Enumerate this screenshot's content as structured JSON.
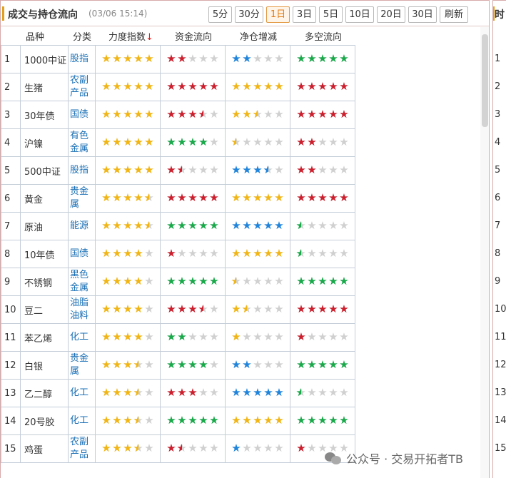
{
  "panel": {
    "title": "成交与持仓流向",
    "timestamp": "(03/06 15:14)",
    "buttons": [
      {
        "label": "5分",
        "active": false
      },
      {
        "label": "30分",
        "active": false
      },
      {
        "label": "1日",
        "active": true
      },
      {
        "label": "3日",
        "active": false
      },
      {
        "label": "5日",
        "active": false
      },
      {
        "label": "10日",
        "active": false
      },
      {
        "label": "20日",
        "active": false
      },
      {
        "label": "30日",
        "active": false
      },
      {
        "label": "刷新",
        "active": false
      }
    ]
  },
  "columns": {
    "name": "品种",
    "category": "分类",
    "strength": "力度指数",
    "strength_sort": "↓",
    "capital": "资金流向",
    "position": "净仓增减",
    "longshort": "多空流向"
  },
  "colors": {
    "gold": "#f2b614",
    "red": "#cc1f2d",
    "green": "#19a94a",
    "blue": "#1e84dc",
    "empty": "#d0d0d0",
    "category": "#1a6fb5"
  },
  "rows": [
    {
      "idx": "1",
      "name": "1000中证",
      "category": "股指",
      "strength": 5,
      "capital": {
        "v": 2,
        "c": "red"
      },
      "position": {
        "v": 2,
        "c": "blue"
      },
      "longshort": {
        "v": 5,
        "c": "green"
      }
    },
    {
      "idx": "2",
      "name": "生猪",
      "category": "农副产品",
      "strength": 5,
      "capital": {
        "v": 5,
        "c": "red"
      },
      "position": {
        "v": 5,
        "c": "gold"
      },
      "longshort": {
        "v": 5,
        "c": "red"
      }
    },
    {
      "idx": "3",
      "name": "30年债",
      "category": "国债",
      "strength": 5,
      "capital": {
        "v": 3.5,
        "c": "red"
      },
      "position": {
        "v": 2.5,
        "c": "gold"
      },
      "longshort": {
        "v": 5,
        "c": "red"
      }
    },
    {
      "idx": "4",
      "name": "沪镍",
      "category": "有色金属",
      "strength": 5,
      "capital": {
        "v": 4,
        "c": "green"
      },
      "position": {
        "v": 0.5,
        "c": "gold"
      },
      "longshort": {
        "v": 2,
        "c": "red"
      }
    },
    {
      "idx": "5",
      "name": "500中证",
      "category": "股指",
      "strength": 5,
      "capital": {
        "v": 1.5,
        "c": "red"
      },
      "position": {
        "v": 3.5,
        "c": "blue"
      },
      "longshort": {
        "v": 2,
        "c": "red"
      }
    },
    {
      "idx": "6",
      "name": "黄金",
      "category": "贵金属",
      "strength": 4.5,
      "capital": {
        "v": 5,
        "c": "red"
      },
      "position": {
        "v": 5,
        "c": "gold"
      },
      "longshort": {
        "v": 5,
        "c": "red"
      }
    },
    {
      "idx": "7",
      "name": "原油",
      "category": "能源",
      "strength": 4.5,
      "capital": {
        "v": 5,
        "c": "green"
      },
      "position": {
        "v": 5,
        "c": "blue"
      },
      "longshort": {
        "v": 0.5,
        "c": "green"
      }
    },
    {
      "idx": "8",
      "name": "10年债",
      "category": "国债",
      "strength": 4,
      "capital": {
        "v": 1,
        "c": "red"
      },
      "position": {
        "v": 5,
        "c": "gold"
      },
      "longshort": {
        "v": 0.5,
        "c": "green"
      }
    },
    {
      "idx": "9",
      "name": "不锈钢",
      "category": "黑色金属",
      "strength": 4,
      "capital": {
        "v": 5,
        "c": "green"
      },
      "position": {
        "v": 0.5,
        "c": "gold"
      },
      "longshort": {
        "v": 5,
        "c": "green"
      }
    },
    {
      "idx": "10",
      "name": "豆二",
      "category": "油脂油料",
      "strength": 4,
      "capital": {
        "v": 3.5,
        "c": "red"
      },
      "position": {
        "v": 1.5,
        "c": "gold"
      },
      "longshort": {
        "v": 5,
        "c": "red"
      }
    },
    {
      "idx": "11",
      "name": "苯乙烯",
      "category": "化工",
      "strength": 4,
      "capital": {
        "v": 2,
        "c": "green"
      },
      "position": {
        "v": 1,
        "c": "gold"
      },
      "longshort": {
        "v": 1,
        "c": "red"
      }
    },
    {
      "idx": "12",
      "name": "白银",
      "category": "贵金属",
      "strength": 3.5,
      "capital": {
        "v": 4,
        "c": "green"
      },
      "position": {
        "v": 2,
        "c": "blue"
      },
      "longshort": {
        "v": 5,
        "c": "green"
      }
    },
    {
      "idx": "13",
      "name": "乙二醇",
      "category": "化工",
      "strength": 3.5,
      "capital": {
        "v": 3,
        "c": "red"
      },
      "position": {
        "v": 5,
        "c": "blue"
      },
      "longshort": {
        "v": 0.5,
        "c": "green"
      }
    },
    {
      "idx": "14",
      "name": "20号胶",
      "category": "化工",
      "strength": 3.5,
      "capital": {
        "v": 5,
        "c": "green"
      },
      "position": {
        "v": 5,
        "c": "gold"
      },
      "longshort": {
        "v": 5,
        "c": "green"
      }
    },
    {
      "idx": "15",
      "name": "鸡蛋",
      "category": "农副产品",
      "strength": 3.5,
      "capital": {
        "v": 1.5,
        "c": "red"
      },
      "position": {
        "v": 1,
        "c": "blue"
      },
      "longshort": {
        "v": 1,
        "c": "red"
      }
    }
  ],
  "side_panel": {
    "title": "时",
    "indices": [
      "1",
      "2",
      "3",
      "4",
      "5",
      "6",
      "7",
      "8",
      "9",
      "10",
      "11",
      "12",
      "13",
      "14",
      "15"
    ]
  },
  "watermark": {
    "icon": "wechat-icon",
    "text": "公众号 · 交易开拓者TB"
  }
}
